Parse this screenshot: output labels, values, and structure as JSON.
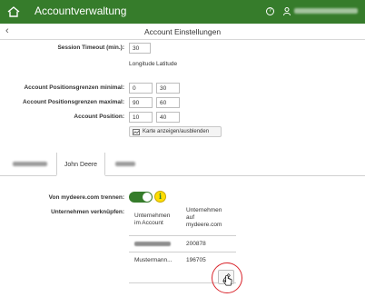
{
  "topbar": {
    "app_title": "Accountverwaltung",
    "home_icon": "home-icon",
    "help_icon": "help-circle-icon",
    "user_icon": "user-icon"
  },
  "subheader": {
    "back_icon": "chevron-left-icon",
    "title": "Account Einstellungen"
  },
  "settings": {
    "session_timeout_label": "Session Timeout (min.):",
    "session_timeout_value": "30",
    "col_longitude": "Longitude",
    "col_latitude": "Latitude",
    "min_label": "Account Positionsgrenzen minimal:",
    "min_longitude": "0",
    "min_latitude": "30",
    "max_label": "Account Positionsgrenzen maximal:",
    "max_longitude": "90",
    "max_latitude": "60",
    "position_label": "Account Position:",
    "position_longitude": "10",
    "position_latitude": "40",
    "map_button": "Karte anzeigen/ausblenden"
  },
  "tabs": {
    "active": "John Deere"
  },
  "connection": {
    "disconnect_label": "Von mydeere.com trennen:",
    "toggle_on": true,
    "link_label": "Unternehmen verknüpfen:",
    "col_company_account": "Unternehmen im Account",
    "col_company_mydeere": "Unternehmen auf mydeere.com",
    "row1_value": "200878",
    "row2_name": "Mustermann...",
    "row2_value": "196705"
  },
  "colors": {
    "brand_green": "#367c2b",
    "info_yellow": "#ffde00",
    "highlight_red": "#d9242b"
  }
}
